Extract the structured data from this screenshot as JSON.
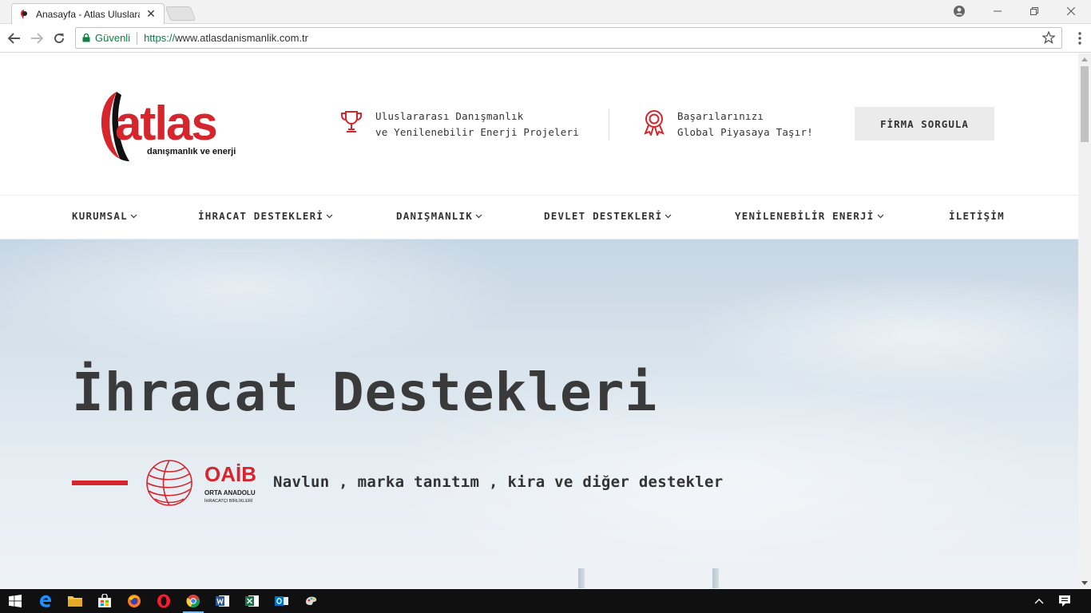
{
  "browser": {
    "tab_title": "Anasayfa - Atlas Uluslara",
    "tab_close": "✕",
    "secure_label": "Güvenli",
    "url_scheme": "https://",
    "url_host": "www.atlasdanismanlik.com.tr"
  },
  "header": {
    "info1": {
      "line1": "Uluslararası Danışmanlık",
      "line2": "ve Yenilenebilir Enerji Projeleri",
      "icon": "trophy-icon"
    },
    "info2": {
      "line1": "Başarılarınızı",
      "line2": "Global Piyasaya Taşır!",
      "icon": "award-ribbon-icon"
    },
    "cta_label": "FİRMA SORGULA"
  },
  "logo": {
    "word": "atlas",
    "tagline": "danışmanlık ve enerji"
  },
  "nav": {
    "items": [
      {
        "label": "KURUMSAL",
        "dropdown": true
      },
      {
        "label": "İHRACAT DESTEKLERİ",
        "dropdown": true
      },
      {
        "label": "DANIŞMANLIK",
        "dropdown": true
      },
      {
        "label": "DEVLET DESTEKLERİ",
        "dropdown": true
      },
      {
        "label": "YENİLENEBİLİR ENERJİ",
        "dropdown": true
      },
      {
        "label": "İLETİŞİM",
        "dropdown": false
      }
    ]
  },
  "hero": {
    "title": "İhracat Destekleri",
    "subtitle": "Navlun , marka tanıtım , kira ve diğer destekler",
    "partner_logo": {
      "name": "OAİB",
      "line1": "ORTA ANADOLU",
      "line2": "İHRACATÇI BİRLİKLERİ"
    }
  },
  "colors": {
    "brand_red": "#d6262d",
    "text_dark": "#333333",
    "cta_bg": "#ebebeb",
    "secure_green": "#0b8043"
  }
}
